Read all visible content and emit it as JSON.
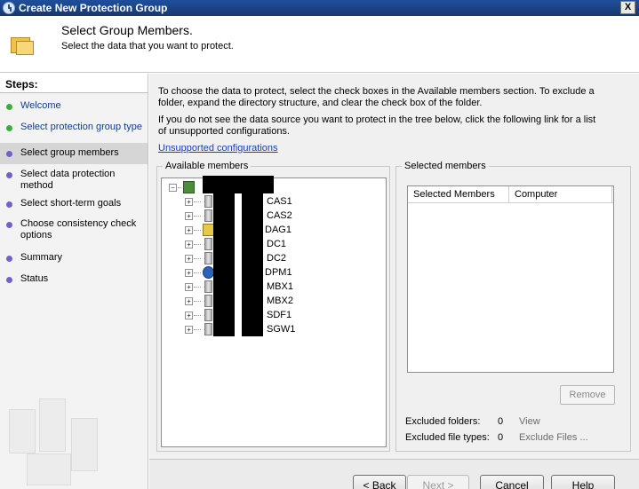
{
  "window": {
    "title": "Create New Protection Group",
    "close_label": "X"
  },
  "header": {
    "title": "Select Group Members.",
    "subtitle": "Select the data that you want to protect."
  },
  "steps": {
    "heading": "Steps:",
    "items": [
      {
        "label": "Welcome",
        "state": "done"
      },
      {
        "label": "Select protection group type",
        "state": "done"
      },
      {
        "label": "Select group members",
        "state": "current"
      },
      {
        "label": "Select data protection method",
        "state": "todo"
      },
      {
        "label": "Select short-term goals",
        "state": "todo"
      },
      {
        "label": "Choose consistency check options",
        "state": "todo"
      },
      {
        "label": "Summary",
        "state": "todo"
      },
      {
        "label": "Status",
        "state": "todo"
      }
    ]
  },
  "main": {
    "intro1": "To choose the data to protect, select the check boxes in the Available members section. To exclude a folder, expand the directory structure, and clear the check box of the folder.",
    "intro2": "If you do not see the data source you want to protect in the tree below, click the following link for a list of unsupported configurations.",
    "link": "Unsupported configurations",
    "available": {
      "legend": "Available members",
      "nodes": [
        "CAS1",
        "CAS2",
        "DAG1",
        "DC1",
        "DC2",
        "DPM1",
        "MBX1",
        "MBX2",
        "SDF1",
        "SGW1"
      ]
    },
    "selected": {
      "legend": "Selected members",
      "col1": "Selected Members",
      "col2": "Computer",
      "remove": "Remove",
      "excluded_folders_label": "Excluded folders:",
      "excluded_folders_count": "0",
      "view": "View",
      "excluded_types_label": "Excluded file types:",
      "excluded_types_count": "0",
      "exclude_files": "Exclude Files ..."
    }
  },
  "buttons": {
    "back": "< Back",
    "next": "Next >",
    "cancel": "Cancel",
    "help": "Help"
  }
}
